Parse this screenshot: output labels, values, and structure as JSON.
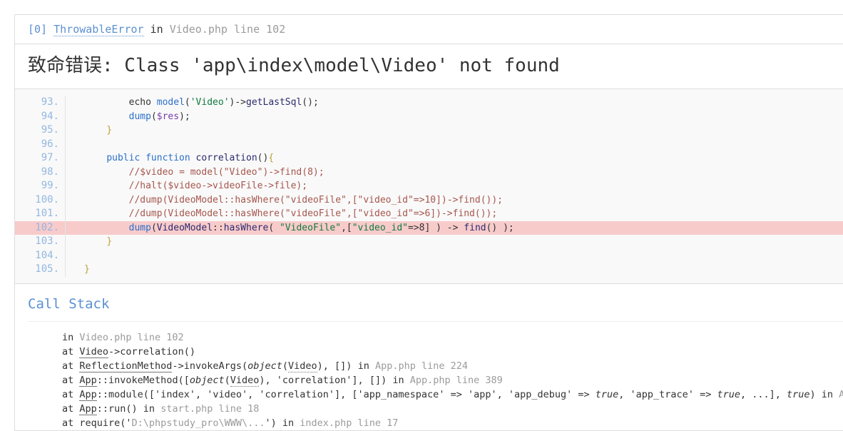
{
  "exception": {
    "index": "[0]",
    "type": "ThrowableError",
    "in_word": " in ",
    "location": "Video.php line 102",
    "title": "致命错误: Class 'app\\index\\model\\Video' not found"
  },
  "source": {
    "lines": [
      {
        "number": "93.",
        "highlight": false,
        "tokens": [
          {
            "t": "        ",
            "c": "t-pun"
          },
          {
            "t": "echo ",
            "c": "t-pun"
          },
          {
            "t": "model",
            "c": "t-fn"
          },
          {
            "t": "(",
            "c": "t-pun"
          },
          {
            "t": "'Video'",
            "c": "t-str"
          },
          {
            "t": ")->",
            "c": "t-pun"
          },
          {
            "t": "getLastSql",
            "c": "t-name"
          },
          {
            "t": "();",
            "c": "t-pun"
          }
        ]
      },
      {
        "number": "94.",
        "highlight": false,
        "tokens": [
          {
            "t": "        ",
            "c": "t-pun"
          },
          {
            "t": "dump",
            "c": "t-fn"
          },
          {
            "t": "(",
            "c": "t-pun"
          },
          {
            "t": "$res",
            "c": "t-var"
          },
          {
            "t": ");",
            "c": "t-pun"
          }
        ]
      },
      {
        "number": "95.",
        "highlight": false,
        "tokens": [
          {
            "t": "    ",
            "c": "t-pun"
          },
          {
            "t": "}",
            "c": "t-brace"
          }
        ]
      },
      {
        "number": "96.",
        "highlight": false,
        "tokens": []
      },
      {
        "number": "97.",
        "highlight": false,
        "tokens": [
          {
            "t": "    ",
            "c": "t-pun"
          },
          {
            "t": "public function ",
            "c": "t-kw"
          },
          {
            "t": "correlation",
            "c": "t-name"
          },
          {
            "t": "()",
            "c": "t-pun"
          },
          {
            "t": "{",
            "c": "t-brace"
          }
        ]
      },
      {
        "number": "98.",
        "highlight": false,
        "tokens": [
          {
            "t": "        ",
            "c": "t-pun"
          },
          {
            "t": "//$video = model(\"Video\")->find(8);",
            "c": "t-com"
          }
        ]
      },
      {
        "number": "99.",
        "highlight": false,
        "tokens": [
          {
            "t": "        ",
            "c": "t-pun"
          },
          {
            "t": "//halt($video->videoFile->file);",
            "c": "t-com"
          }
        ]
      },
      {
        "number": "100.",
        "highlight": false,
        "tokens": [
          {
            "t": "        ",
            "c": "t-pun"
          },
          {
            "t": "//dump(VideoModel::hasWhere(\"videoFile\",[\"video_id\"=>10])->find());",
            "c": "t-com"
          }
        ]
      },
      {
        "number": "101.",
        "highlight": false,
        "tokens": [
          {
            "t": "        ",
            "c": "t-pun"
          },
          {
            "t": "//dump(VideoModel::hasWhere(\"videoFile\",[\"video_id\"=>6])->find());",
            "c": "t-com"
          }
        ]
      },
      {
        "number": "102.",
        "highlight": true,
        "tokens": [
          {
            "t": "        ",
            "c": "t-pun"
          },
          {
            "t": "dump",
            "c": "t-fn"
          },
          {
            "t": "(",
            "c": "t-pun"
          },
          {
            "t": "VideoModel",
            "c": "t-name"
          },
          {
            "t": "::",
            "c": "t-pun"
          },
          {
            "t": "hasWhere",
            "c": "t-name"
          },
          {
            "t": "( ",
            "c": "t-pun"
          },
          {
            "t": "\"VideoFile\"",
            "c": "t-str"
          },
          {
            "t": ",[",
            "c": "t-pun"
          },
          {
            "t": "\"video_id\"",
            "c": "t-str"
          },
          {
            "t": "=>8] ) -> ",
            "c": "t-pun"
          },
          {
            "t": "find",
            "c": "t-name"
          },
          {
            "t": "() );",
            "c": "t-pun"
          }
        ]
      },
      {
        "number": "103.",
        "highlight": false,
        "tokens": [
          {
            "t": "    ",
            "c": "t-pun"
          },
          {
            "t": "}",
            "c": "t-brace"
          }
        ]
      },
      {
        "number": "104.",
        "highlight": false,
        "tokens": []
      },
      {
        "number": "105.",
        "highlight": false,
        "tokens": [
          {
            "t": "}",
            "c": "t-brace"
          }
        ]
      }
    ]
  },
  "trace": {
    "title": "Call Stack",
    "items": [
      {
        "parts": [
          {
            "t": "in ",
            "c": ""
          },
          {
            "t": "Video.php line 102",
            "c": "tr-file"
          }
        ]
      },
      {
        "parts": [
          {
            "t": "at ",
            "c": ""
          },
          {
            "t": "Video",
            "c": "tr-cls"
          },
          {
            "t": "->correlation()",
            "c": ""
          }
        ]
      },
      {
        "parts": [
          {
            "t": "at ",
            "c": ""
          },
          {
            "t": "ReflectionMethod",
            "c": "tr-cls"
          },
          {
            "t": "->invokeArgs(",
            "c": ""
          },
          {
            "t": "object",
            "c": "tr-it"
          },
          {
            "t": "(",
            "c": ""
          },
          {
            "t": "Video",
            "c": "tr-dot"
          },
          {
            "t": "), []) in ",
            "c": ""
          },
          {
            "t": "App.php line 224",
            "c": "tr-file"
          }
        ]
      },
      {
        "parts": [
          {
            "t": "at ",
            "c": ""
          },
          {
            "t": "App",
            "c": "tr-cls"
          },
          {
            "t": "::invokeMethod([",
            "c": ""
          },
          {
            "t": "object",
            "c": "tr-it"
          },
          {
            "t": "(",
            "c": ""
          },
          {
            "t": "Video",
            "c": "tr-dot"
          },
          {
            "t": "), 'correlation'], []) in ",
            "c": ""
          },
          {
            "t": "App.php line 389",
            "c": "tr-file"
          }
        ]
      },
      {
        "parts": [
          {
            "t": "at ",
            "c": ""
          },
          {
            "t": "App",
            "c": "tr-cls"
          },
          {
            "t": "::module(['index', 'video', 'correlation'], ['app_namespace' => 'app', 'app_debug' => ",
            "c": ""
          },
          {
            "t": "true",
            "c": "tr-it"
          },
          {
            "t": ", 'app_trace' => ",
            "c": ""
          },
          {
            "t": "true",
            "c": "tr-it"
          },
          {
            "t": ", ...], ",
            "c": ""
          },
          {
            "t": "true",
            "c": "tr-it"
          },
          {
            "t": ") in ",
            "c": ""
          },
          {
            "t": "App.php l",
            "c": "tr-file"
          }
        ]
      },
      {
        "parts": [
          {
            "t": "at ",
            "c": ""
          },
          {
            "t": "App",
            "c": "tr-cls"
          },
          {
            "t": "::run() in ",
            "c": ""
          },
          {
            "t": "start.php line 18",
            "c": "tr-file"
          }
        ]
      },
      {
        "parts": [
          {
            "t": "at require('",
            "c": ""
          },
          {
            "t": "D:\\phpstudy_pro\\WWW\\...",
            "c": "tr-file"
          },
          {
            "t": "') in ",
            "c": ""
          },
          {
            "t": "index.php line 17",
            "c": "tr-file"
          }
        ]
      }
    ]
  },
  "colors": {
    "link": "#5c90d2",
    "highlight_row": "#f8cbcb",
    "line_number": "#93b7e0",
    "source_bg": "#f9f9f9",
    "muted": "#9b9b9b"
  }
}
